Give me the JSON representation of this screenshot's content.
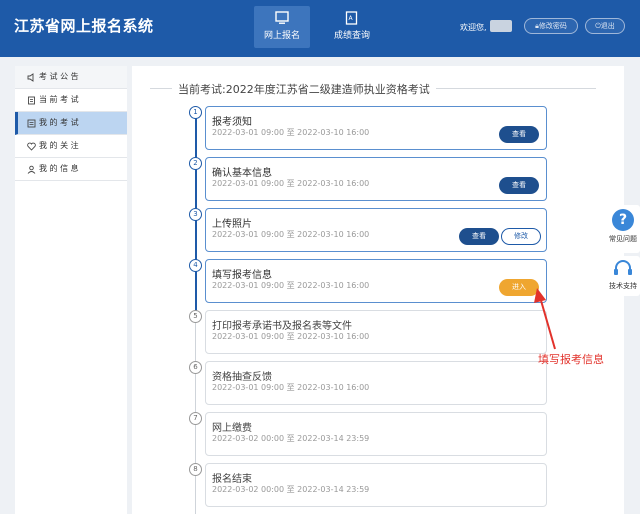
{
  "header": {
    "title": "江苏省网上报名系统",
    "nav": [
      {
        "label": "网上报名",
        "icon": "monitor-icon",
        "active": true
      },
      {
        "label": "成绩查询",
        "icon": "score-search-icon",
        "active": false
      }
    ],
    "welcome": "欢迎您,",
    "change_password": "修改密码",
    "logout": "退出"
  },
  "sidebar": {
    "items": [
      {
        "label": "考 试 公 告",
        "icon": "speaker-icon"
      },
      {
        "label": "当 前 考 试",
        "icon": "document-icon"
      },
      {
        "label": "我 的 考 试",
        "icon": "list-icon"
      },
      {
        "label": "我 的 关 注",
        "icon": "heart-icon"
      },
      {
        "label": "我 的 信 息",
        "icon": "user-icon"
      }
    ]
  },
  "main": {
    "exam_title": "当前考试:2022年度江苏省二级建造师执业资格考试",
    "steps": [
      {
        "num": "1",
        "title": "报考须知",
        "time": "2022-03-01 09:00 至 2022-03-10 16:00",
        "btn": "查看"
      },
      {
        "num": "2",
        "title": "确认基本信息",
        "time": "2022-03-01 09:00 至 2022-03-10 16:00",
        "btn": "查看"
      },
      {
        "num": "3",
        "title": "上传照片",
        "time": "2022-03-01 09:00 至 2022-03-10 16:00",
        "btn": "查看",
        "btn2": "修改"
      },
      {
        "num": "4",
        "title": "填写报考信息",
        "time": "2022-03-01 09:00 至 2022-03-10 16:00",
        "btn": "进入"
      },
      {
        "num": "5",
        "title": "打印报考承诺书及报名表等文件",
        "time": "2022-03-01 09:00 至 2022-03-10 16:00"
      },
      {
        "num": "6",
        "title": "资格抽查反馈",
        "time": "2022-03-01 09:00 至 2022-03-10 16:00"
      },
      {
        "num": "7",
        "title": "网上缴费",
        "time": "2022-03-02 00:00 至 2022-03-14 23:59"
      },
      {
        "num": "8",
        "title": "报名结束",
        "time": "2022-03-02 00:00 至 2022-03-14 23:59"
      }
    ]
  },
  "annotation": "填写报考信息",
  "float": {
    "help": "常见问题",
    "support": "技术支持"
  },
  "colors": {
    "header": "#1e5aa8",
    "button": "#1e4f8e",
    "enter": "#efa630",
    "annotation": "#e2322b"
  }
}
